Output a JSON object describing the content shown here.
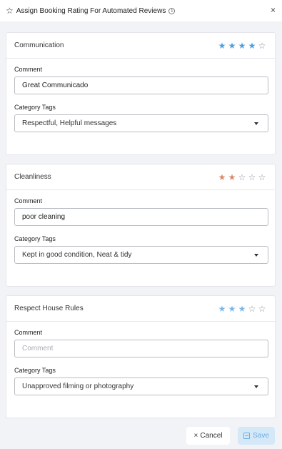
{
  "header": {
    "title": "Assign Booking Rating For Automated Reviews",
    "info_glyph": "i",
    "close_glyph": "×"
  },
  "colors": {
    "star_blue": "#4a9fe0",
    "star_salmon": "#d9896a",
    "star_empty": "#8d9199"
  },
  "sections": [
    {
      "title": "Communication",
      "rating": 4,
      "star_color": "#4a9fe0",
      "comment_label": "Comment",
      "comment_value": "Great Communicado",
      "comment_placeholder": "Comment",
      "tags_label": "Category Tags",
      "tags_value": "Respectful, Helpful messages"
    },
    {
      "title": "Cleanliness",
      "rating": 2,
      "star_color": "#d9896a",
      "comment_label": "Comment",
      "comment_value": "poor cleaning",
      "comment_placeholder": "Comment",
      "tags_label": "Category Tags",
      "tags_value": "Kept in good condition, Neat & tidy"
    },
    {
      "title": "Respect House Rules",
      "rating": 3,
      "star_color": "#7ab7e6",
      "comment_label": "Comment",
      "comment_value": "",
      "comment_placeholder": "Comment",
      "tags_label": "Category Tags",
      "tags_value": "Unapproved filming or photography"
    }
  ],
  "footer": {
    "cancel_label": "Cancel",
    "save_label": "Save"
  }
}
